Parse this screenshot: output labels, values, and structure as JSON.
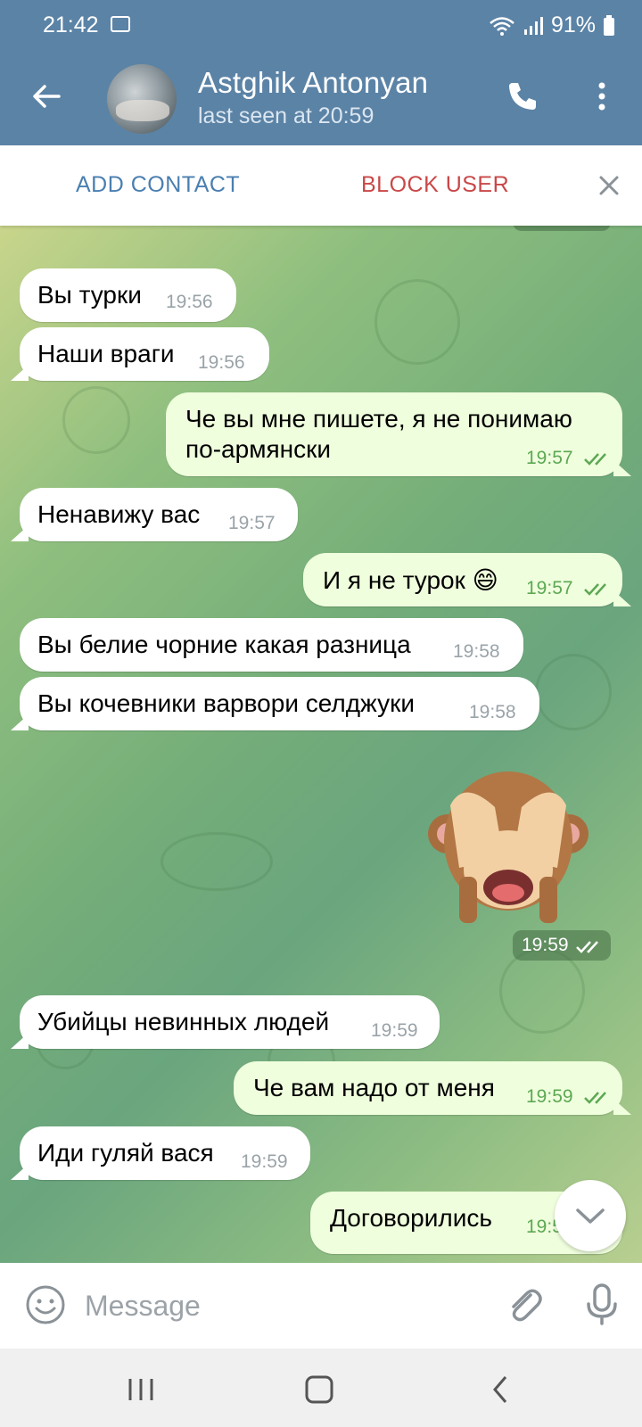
{
  "status_bar": {
    "time": "21:42",
    "battery": "91%"
  },
  "header": {
    "name": "Astghik Antonyan",
    "last_seen": "last seen at 20:59"
  },
  "action_bar": {
    "add_contact": "ADD CONTACT",
    "block_user": "BLOCK USER"
  },
  "messages": [
    {
      "text": "Вы турки",
      "time": "19:56",
      "dir": "in"
    },
    {
      "text": "Наши враги",
      "time": "19:56",
      "dir": "in"
    },
    {
      "line1": "Че вы мне пишете, я не понимаю",
      "line2": "по-армянски",
      "time": "19:57",
      "dir": "out"
    },
    {
      "text": "Ненавижу вас",
      "time": "19:57",
      "dir": "in"
    },
    {
      "text": "И я не турок 😄",
      "time": "19:57",
      "dir": "out"
    },
    {
      "text": "Вы белие чорние какая разница",
      "time": "19:58",
      "dir": "in"
    },
    {
      "text": "Вы кочевники варвори селджуки",
      "time": "19:58",
      "dir": "in"
    },
    {
      "sticker": "🙈",
      "time": "19:59",
      "dir": "out"
    },
    {
      "text": "Убийцы невинных людей",
      "time": "19:59",
      "dir": "in"
    },
    {
      "text": "Че вам надо от меня",
      "time": "19:59",
      "dir": "out"
    },
    {
      "text": "Иди гуляй вася",
      "time": "19:59",
      "dir": "in"
    },
    {
      "text": "Договорились",
      "time": "19:59",
      "dir": "out"
    }
  ],
  "input": {
    "placeholder": "Message"
  },
  "colors": {
    "header": "#5b83a6",
    "outgoing_bubble": "#effedd",
    "incoming_bubble": "#ffffff",
    "block": "#c94848",
    "add": "#4a7fb0"
  }
}
